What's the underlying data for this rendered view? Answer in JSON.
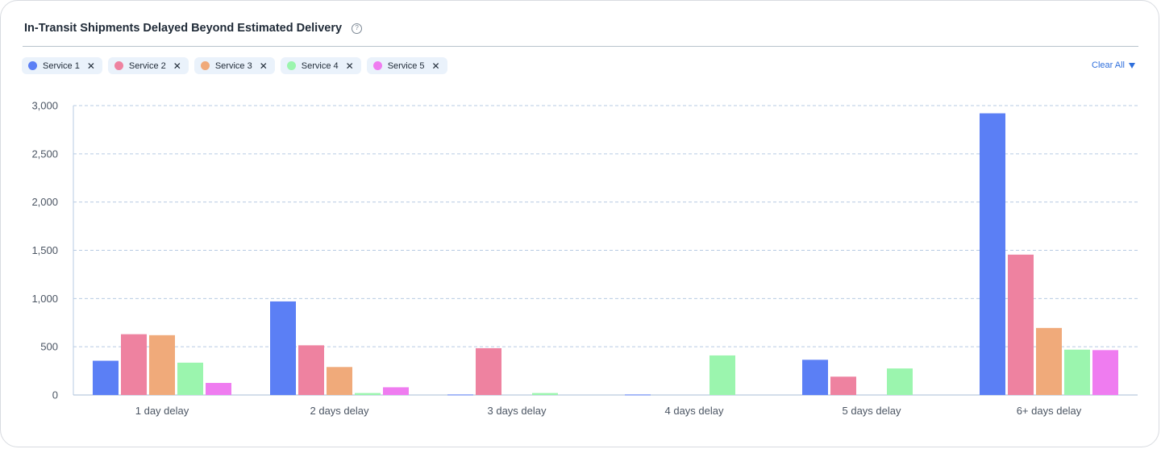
{
  "card": {
    "title": "In-Transit Shipments Delayed Beyond Estimated Delivery",
    "help_icon": "question-circle-icon"
  },
  "filters": {
    "chips": [
      {
        "label": "Service 1",
        "color": "#5b7ff5",
        "close": "✕"
      },
      {
        "label": "Service 2",
        "color": "#ee82a0",
        "close": "✕"
      },
      {
        "label": "Service 3",
        "color": "#f0aa7a",
        "close": "✕"
      },
      {
        "label": "Service 4",
        "color": "#9bf5ae",
        "close": "✕"
      },
      {
        "label": "Service 5",
        "color": "#ef7cf0",
        "close": "✕"
      }
    ],
    "clear_all_label": "Clear All"
  },
  "chart_data": {
    "type": "bar",
    "categories": [
      "1 day delay",
      "2 days delay",
      "3 days delay",
      "4 days delay",
      "5 days delay",
      "6+ days delay"
    ],
    "series": [
      {
        "name": "Service 1",
        "color": "#5b7ff5",
        "values": [
          355,
          970,
          5,
          5,
          365,
          2920
        ]
      },
      {
        "name": "Service 2",
        "color": "#ee82a0",
        "values": [
          630,
          515,
          485,
          0,
          190,
          1455
        ]
      },
      {
        "name": "Service 3",
        "color": "#f0aa7a",
        "values": [
          620,
          290,
          0,
          0,
          0,
          695
        ]
      },
      {
        "name": "Service 4",
        "color": "#9bf5ae",
        "values": [
          335,
          20,
          20,
          410,
          275,
          470
        ]
      },
      {
        "name": "Service 5",
        "color": "#ef7cf0",
        "values": [
          125,
          80,
          0,
          0,
          0,
          465
        ]
      }
    ],
    "ylim": [
      0,
      3000
    ],
    "yticks": [
      0,
      500,
      1000,
      1500,
      2000,
      2500,
      3000
    ],
    "ytick_labels": [
      "0",
      "500",
      "1,000",
      "1,500",
      "2,000",
      "2,500",
      "3,000"
    ],
    "grid": true,
    "legend": "top-left filter chips"
  }
}
